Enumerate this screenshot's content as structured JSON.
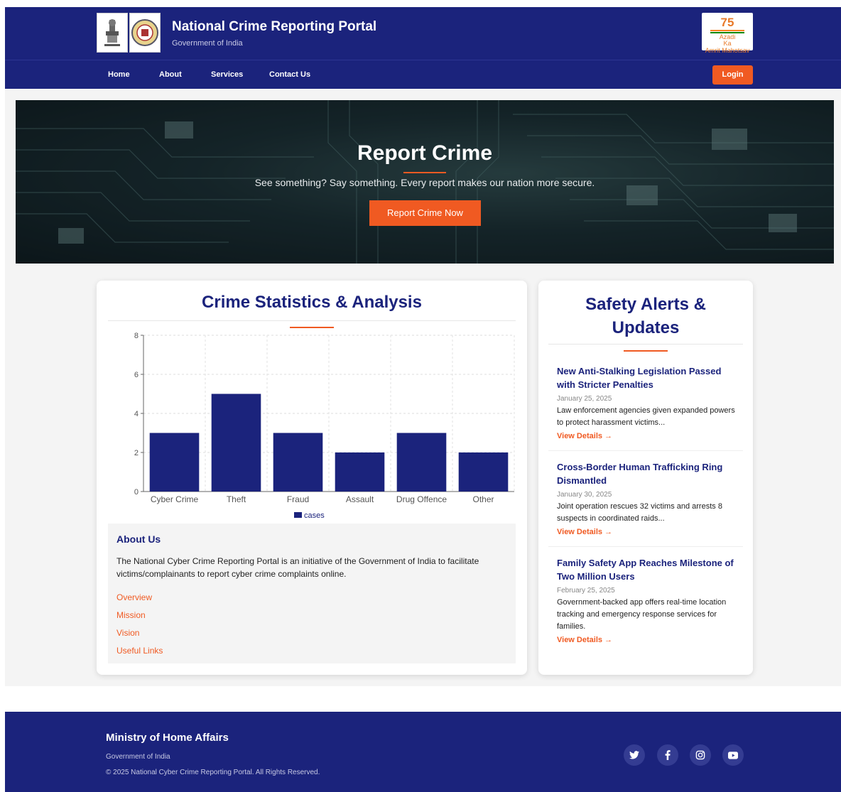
{
  "header": {
    "title": "National Crime Reporting Portal",
    "subtitle": "Government of India",
    "badge_top": "75",
    "badge_line1": "Azadi",
    "badge_line2": "Ka",
    "badge_line3": "Amrit Mahotsav"
  },
  "nav": {
    "items": [
      "Home",
      "About",
      "Services",
      "Contact Us"
    ],
    "login": "Login"
  },
  "hero": {
    "title": "Report Crime",
    "text": "See something? Say something. Every report makes our nation more secure.",
    "button": "Report Crime Now"
  },
  "stats": {
    "title": "Crime Statistics & Analysis"
  },
  "chart_data": {
    "type": "bar",
    "categories": [
      "Cyber Crime",
      "Theft",
      "Fraud",
      "Assault",
      "Drug Offence",
      "Other"
    ],
    "series": [
      {
        "name": "cases",
        "values": [
          3,
          5,
          3,
          2,
          3,
          2
        ]
      }
    ],
    "ylim": [
      0,
      8
    ],
    "yticks": [
      0,
      2,
      4,
      6,
      8
    ],
    "grid": true,
    "legend": "bottom",
    "bar_color": "#1b237c"
  },
  "about": {
    "title": "About Us",
    "text": "The National Cyber Crime Reporting Portal is an initiative of the Government of India to facilitate victims/complainants to report cyber crime complaints online.",
    "links": [
      "Overview",
      "Mission",
      "Vision",
      "Useful Links"
    ]
  },
  "alerts": {
    "title_line1": "Safety Alerts &",
    "title_line2": "Updates",
    "items": [
      {
        "title": "New Anti-Stalking Legislation Passed with Stricter Penalties",
        "date": "January 25, 2025",
        "desc": "Law enforcement agencies given expanded powers to protect harassment victims...",
        "link": "View Details →"
      },
      {
        "title": "Cross-Border Human Trafficking Ring Dismantled",
        "date": "January 30, 2025",
        "desc": "Joint operation rescues 32 victims and arrests 8 suspects in coordinated raids...",
        "link": "View Details →"
      },
      {
        "title": "Family Safety App Reaches Milestone of Two Million Users",
        "date": "February 25, 2025",
        "desc": "Government-backed app offers real-time location tracking and emergency response services for families.",
        "link": "View Details →"
      }
    ]
  },
  "footer": {
    "title": "Ministry of Home Affairs",
    "subtitle": "Government of India",
    "copyright": "© 2025 National Cyber Crime Reporting Portal. All Rights Reserved.",
    "social": [
      "twitter-icon",
      "facebook-icon",
      "instagram-icon",
      "youtube-icon"
    ]
  },
  "colors": {
    "primary": "#1b237c",
    "accent": "#f05a22"
  }
}
